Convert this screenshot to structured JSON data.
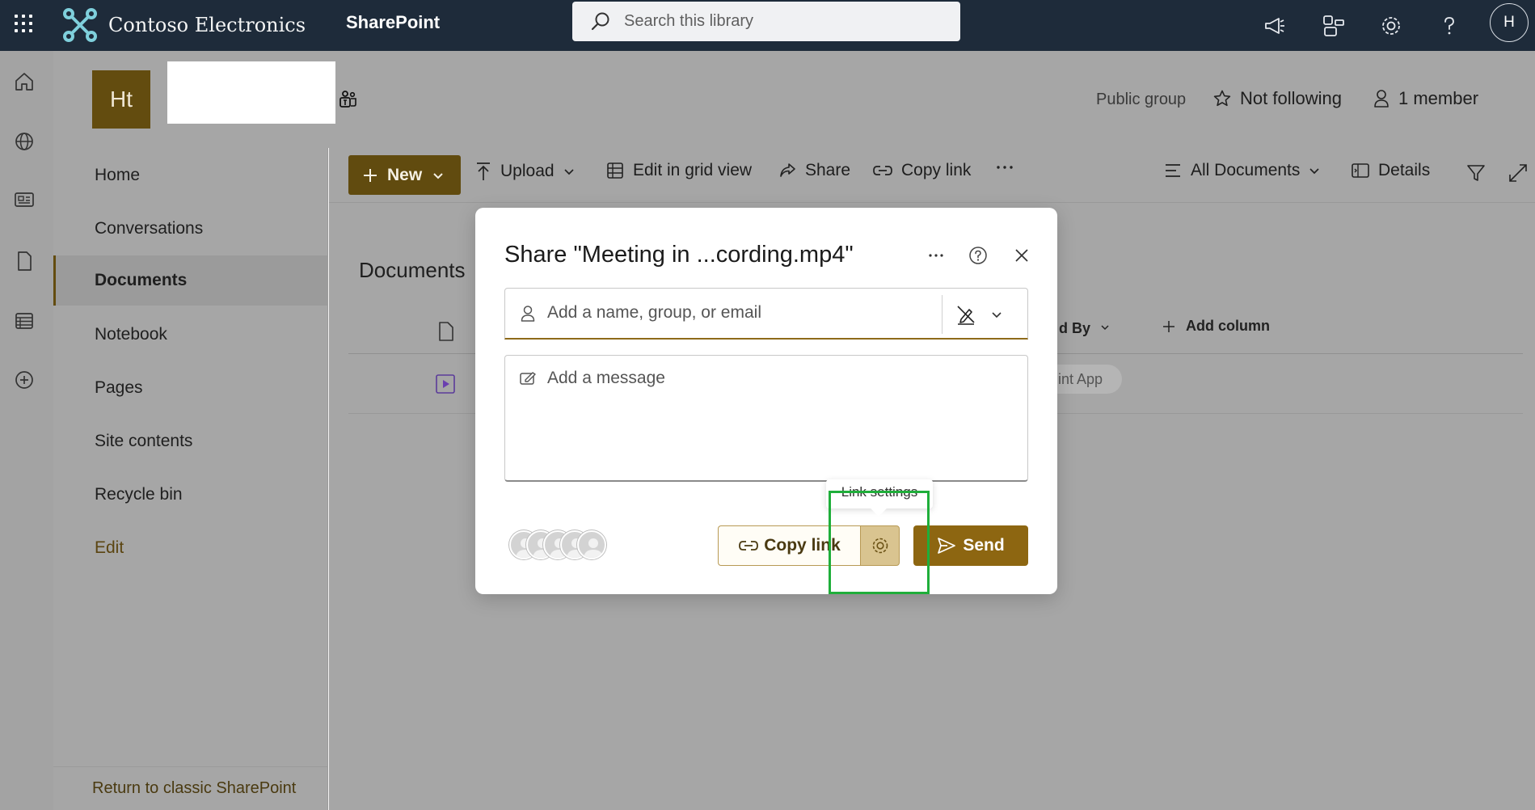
{
  "topbar": {
    "brand_name": "Contoso Electronics",
    "app_name": "SharePoint",
    "search_placeholder": "Search this library",
    "user_initial": "H"
  },
  "site": {
    "logo_initials": "Ht",
    "group_type": "Public group",
    "follow_label": "Not following",
    "members_label": "1 member"
  },
  "leftnav": {
    "items": [
      {
        "label": "Home"
      },
      {
        "label": "Conversations"
      },
      {
        "label": "Documents"
      },
      {
        "label": "Notebook"
      },
      {
        "label": "Pages"
      },
      {
        "label": "Site contents"
      },
      {
        "label": "Recycle bin"
      },
      {
        "label": "Edit"
      }
    ],
    "active_index": 2,
    "return_classic": "Return to classic SharePoint"
  },
  "commandbar": {
    "new_label": "New",
    "upload_label": "Upload",
    "grid_label": "Edit in grid view",
    "share_label": "Share",
    "copylink_label": "Copy link",
    "view_label": "All Documents",
    "details_label": "Details"
  },
  "library": {
    "title": "Documents",
    "modified_by_partial": "d By",
    "add_column": "Add column",
    "app_chip_partial": "int App"
  },
  "share_dialog": {
    "title": "Share \"Meeting in ...cording.mp4\"",
    "recipient_placeholder": "Add a name, group, or email",
    "message_placeholder": "Add a message",
    "copy_link_label": "Copy link",
    "link_settings_tooltip": "Link settings",
    "send_label": "Send"
  },
  "colors": {
    "topbar": "#1e2b3a",
    "accent": "#634c0f",
    "send": "#8d6611",
    "highlight": "#1fae3a"
  }
}
